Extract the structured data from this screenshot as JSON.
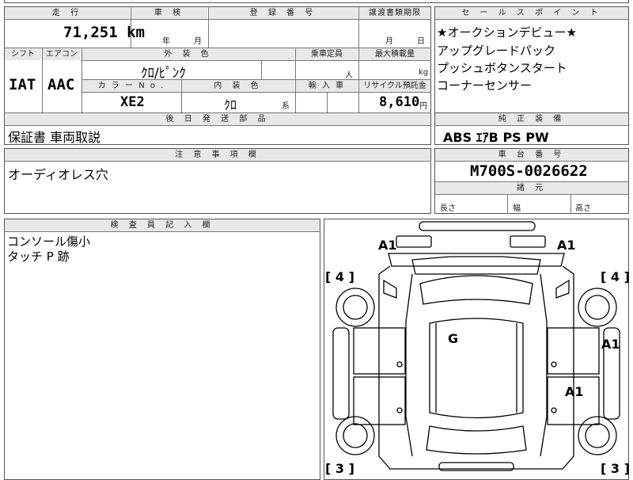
{
  "header_row": {
    "mileage_h": "走 行",
    "inspection_h": "車 検",
    "registration_h": "登 録 番 号",
    "transfer_h": "譲渡書類期限"
  },
  "mileage": {
    "value": "71,251",
    "unit": "km"
  },
  "inspection": {
    "year": "年",
    "month": "月"
  },
  "transfer": {
    "month": "月",
    "day": "日"
  },
  "labels": {
    "shift": "シフト",
    "aircon": "エアコン",
    "exterior": "外 装 色",
    "capacity": "乗車定員",
    "max_load": "最大積載量",
    "color_no": "カ ラ ー N o .",
    "interior": "内 装 色",
    "import": "輸 入 車",
    "recycle": "リサイクル預託金",
    "later_parts": "後 日 発 送 部 品",
    "notes": "注 意 事 項 欄",
    "inspector": "検 査 員 記 入 欄",
    "selling": "セ ー ル ス ポ イ ン ト",
    "equipment": "純 正 装 備",
    "chassis": "車 台 番 号",
    "dims": "諸 元",
    "length": "長さ",
    "width": "幅",
    "height": "高さ"
  },
  "values": {
    "shift": "IAT",
    "aircon": "AAC",
    "exterior_color": "ｸﾛ/ﾋﾟﾝｸ",
    "capacity_unit": "人",
    "max_load_unit": "kg",
    "color_no": "XE2",
    "interior_color": "ｸﾛ",
    "interior_suffix": "系",
    "recycle_fee": "8,610",
    "recycle_unit": "円",
    "later_parts": "保証書 車両取説",
    "notes": "オーディオレス穴",
    "chassis_no": "M700S-0026622",
    "equipment": "ABS ｴｱB PS PW"
  },
  "selling_points": [
    "★オークションデビュー★",
    "アップグレードパック",
    "プッシュボタンスタート",
    "コーナーセンサー"
  ],
  "inspector_notes": [
    "コンソール傷小",
    "タッチ P 跡"
  ],
  "diagram": {
    "marks": {
      "a1_tl": "A1",
      "a1_tr": "A1",
      "a1_r": "A1",
      "a1_rm": "A1",
      "g": "G"
    },
    "brackets": {
      "front_left": "[ 4 ]",
      "front_right": "[ 4 ]",
      "rear_left": "[ 3 ]",
      "rear_right": "[ 3 ]"
    }
  }
}
